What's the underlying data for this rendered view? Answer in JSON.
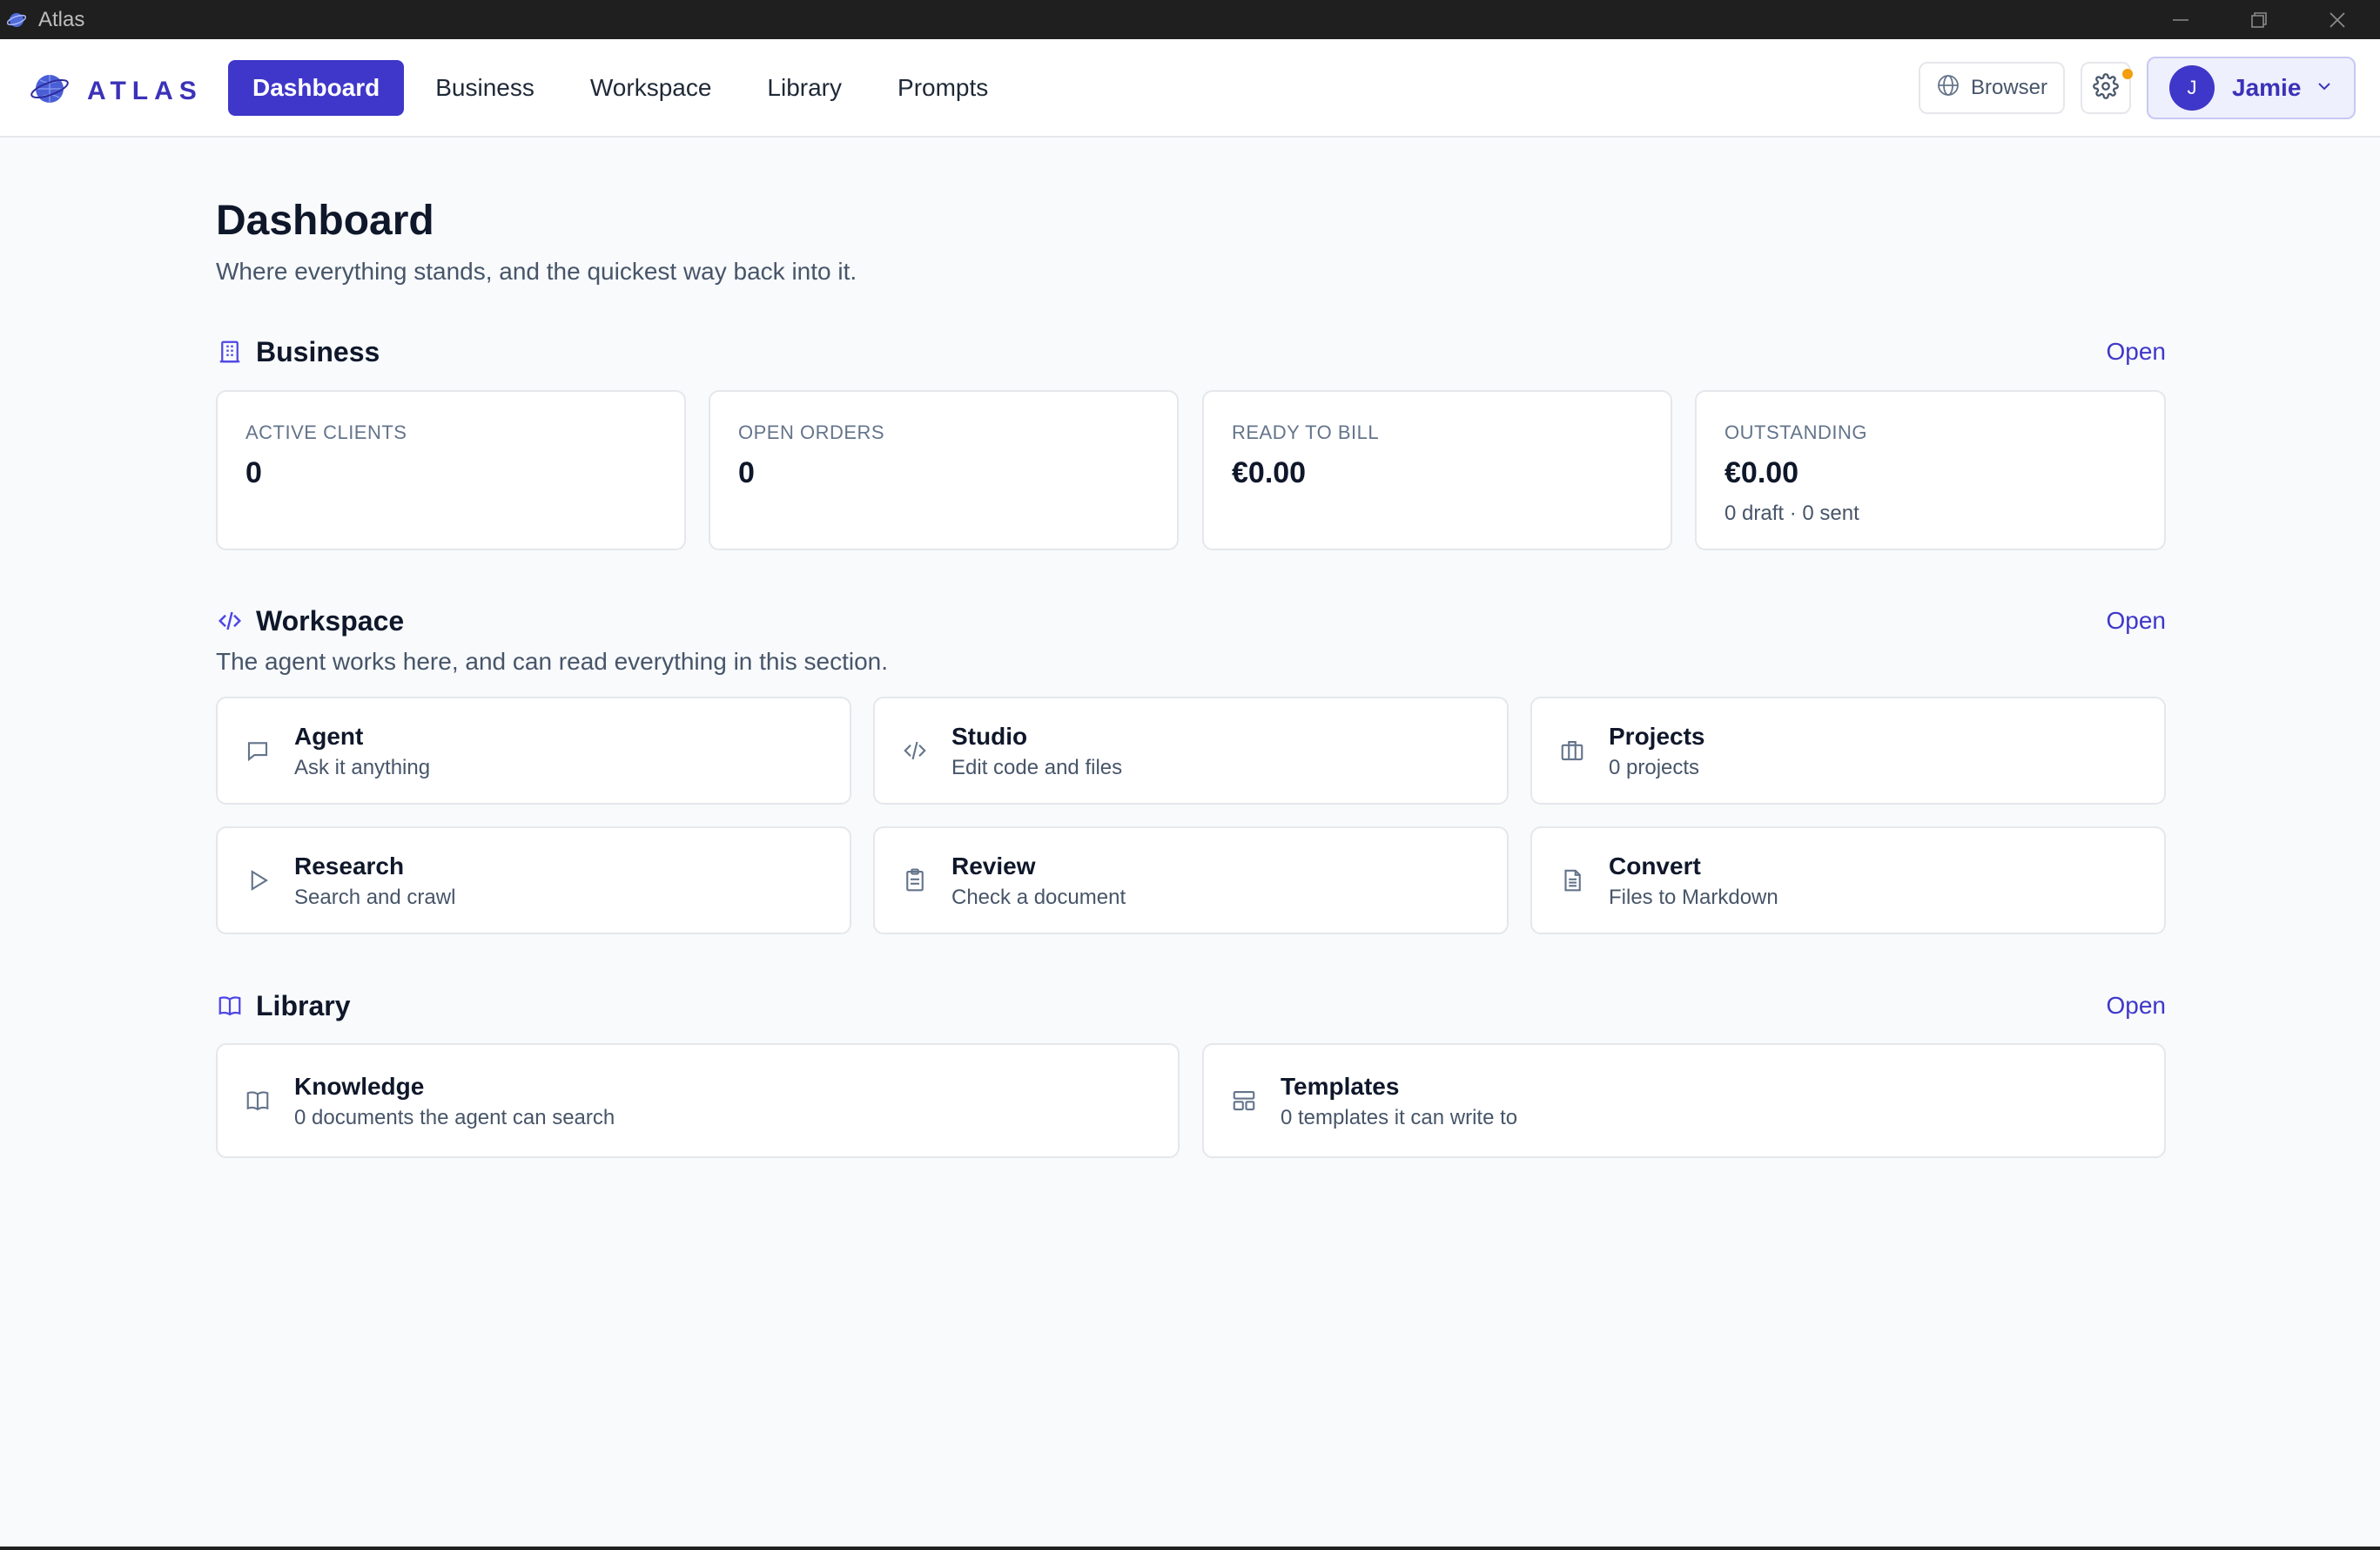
{
  "window": {
    "title": "Atlas",
    "controls": [
      "minimize-icon",
      "restore-icon",
      "close-icon"
    ]
  },
  "nav": {
    "logo_text": "ATLAS",
    "tabs": [
      {
        "label": "Dashboard",
        "active": true
      },
      {
        "label": "Business",
        "active": false
      },
      {
        "label": "Workspace",
        "active": false
      },
      {
        "label": "Library",
        "active": false
      },
      {
        "label": "Prompts",
        "active": false
      }
    ],
    "browser_label": "Browser",
    "user": {
      "initial": "J",
      "name": "Jamie"
    }
  },
  "colors": {
    "accent": "#3f37c9",
    "notification": "#f59e0b",
    "background": "#f8fafc"
  },
  "page": {
    "title": "Dashboard",
    "subtitle": "Where everything stands, and the quickest way back into it."
  },
  "business": {
    "title": "Business",
    "open_label": "Open",
    "stats": [
      {
        "label": "ACTIVE CLIENTS",
        "value": "0",
        "sub": ""
      },
      {
        "label": "OPEN ORDERS",
        "value": "0",
        "sub": ""
      },
      {
        "label": "READY TO BILL",
        "value": "€0.00",
        "sub": ""
      },
      {
        "label": "OUTSTANDING",
        "value": "€0.00",
        "sub": "0 draft · 0 sent"
      }
    ]
  },
  "workspace": {
    "title": "Workspace",
    "open_label": "Open",
    "description": "The agent works here, and can read everything in this section.",
    "tiles": [
      {
        "icon": "chat-icon",
        "title": "Agent",
        "sub": "Ask it anything"
      },
      {
        "icon": "code-icon",
        "title": "Studio",
        "sub": "Edit code and files"
      },
      {
        "icon": "briefcase-icon",
        "title": "Projects",
        "sub": "0 projects"
      },
      {
        "icon": "play-icon",
        "title": "Research",
        "sub": "Search and crawl"
      },
      {
        "icon": "clipboard-icon",
        "title": "Review",
        "sub": "Check a document"
      },
      {
        "icon": "file-text-icon",
        "title": "Convert",
        "sub": "Files to Markdown"
      }
    ]
  },
  "library": {
    "title": "Library",
    "open_label": "Open",
    "tiles": [
      {
        "icon": "book-icon",
        "title": "Knowledge",
        "sub": "0 documents the agent can search"
      },
      {
        "icon": "layout-icon",
        "title": "Templates",
        "sub": "0 templates it can write to"
      }
    ]
  }
}
